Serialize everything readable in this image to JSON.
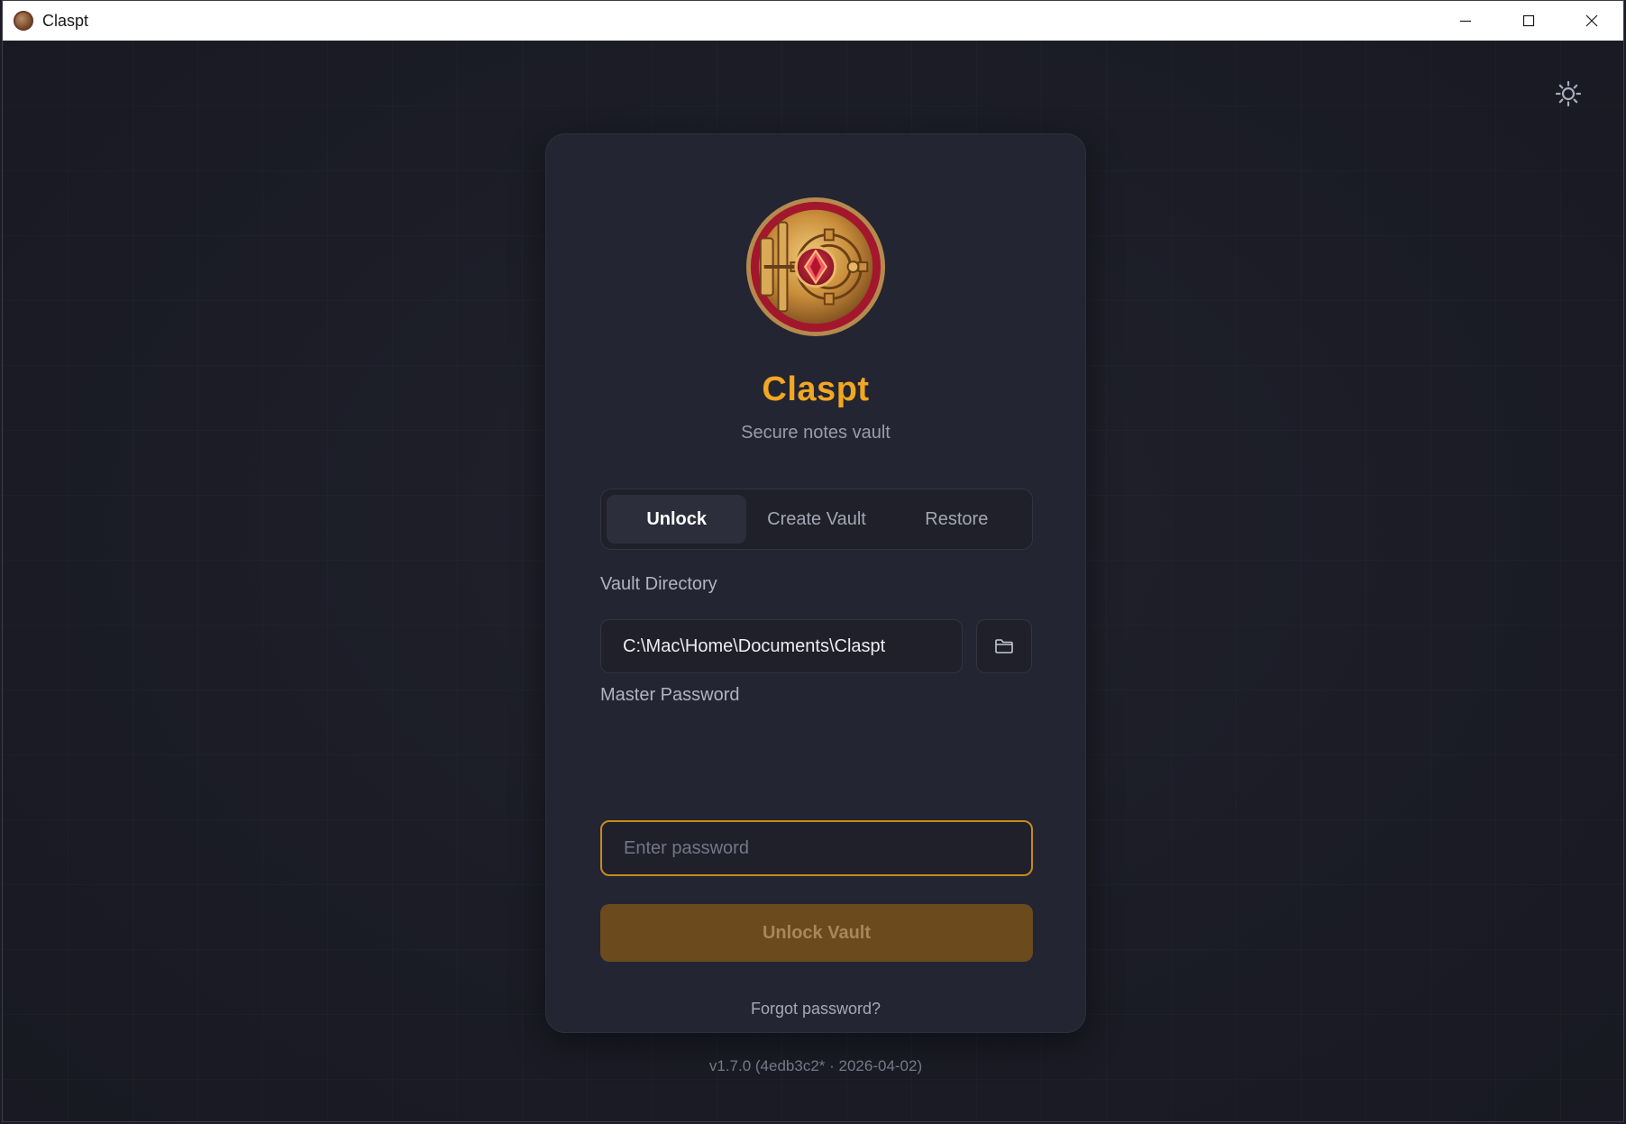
{
  "window": {
    "title": "Claspt"
  },
  "brand": {
    "title": "Claspt",
    "subtitle": "Secure notes vault"
  },
  "tabs": [
    {
      "label": "Unlock",
      "active": true
    },
    {
      "label": "Create Vault",
      "active": false
    },
    {
      "label": "Restore",
      "active": false
    }
  ],
  "vault_directory": {
    "label": "Vault Directory",
    "value": "C:\\Mac\\Home\\Documents\\Claspt"
  },
  "master_password": {
    "label": "Master Password",
    "placeholder": "Enter password",
    "value": ""
  },
  "unlock_button": {
    "label": "Unlock Vault"
  },
  "forgot_link": {
    "label": "Forgot password?"
  },
  "version": {
    "text": "v1.7.0 (4edb3c2* · 2026-04-02)"
  },
  "icons": {
    "theme_toggle": "sun-icon",
    "folder": "folder-icon",
    "minimize": "minimize-icon",
    "maximize": "maximize-icon",
    "close": "close-icon"
  },
  "colors": {
    "accent": "#f0a722",
    "background": "#1b1c26",
    "card": "#242532",
    "button": "#6b4a1e",
    "focus_border": "#c98a1a"
  }
}
